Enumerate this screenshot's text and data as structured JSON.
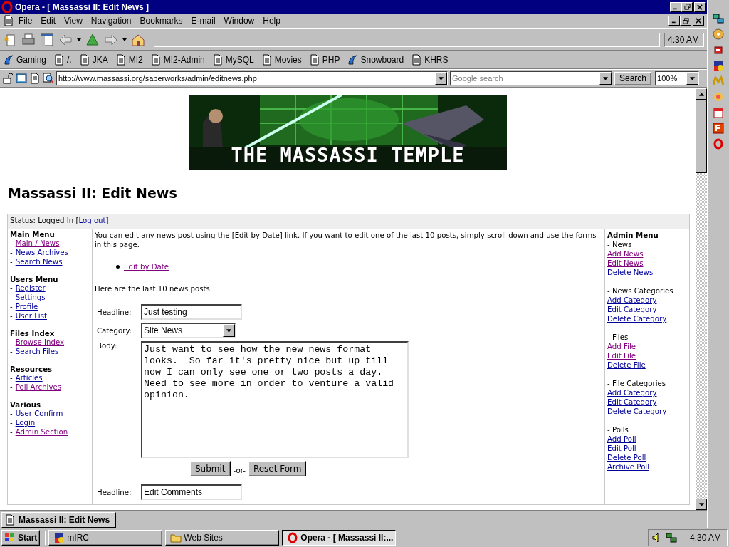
{
  "window": {
    "title": "Opera - [ Massassi II: Edit News ]"
  },
  "menu": [
    "File",
    "Edit",
    "View",
    "Navigation",
    "Bookmarks",
    "E-mail",
    "Window",
    "Help"
  ],
  "toolbar": {
    "clock": "4:30 AM"
  },
  "bookmarks": [
    {
      "label": "Gaming",
      "kind": "web"
    },
    {
      "label": "/.",
      "kind": "page"
    },
    {
      "label": "JKA",
      "kind": "page"
    },
    {
      "label": "MI2",
      "kind": "page"
    },
    {
      "label": "MI2-Admin",
      "kind": "page"
    },
    {
      "label": "MySQL",
      "kind": "page"
    },
    {
      "label": "Movies",
      "kind": "page"
    },
    {
      "label": "PHP",
      "kind": "page"
    },
    {
      "label": "Snowboard",
      "kind": "web"
    },
    {
      "label": "KHRS",
      "kind": "page"
    }
  ],
  "address": {
    "url": "http://www.massassi.org/saberworks/admin/editnews.php",
    "search_placeholder": "Google search",
    "search_button": "Search",
    "zoom": "100%"
  },
  "page": {
    "banner": {
      "title": "THE MASSASSI TEMPLE"
    },
    "heading": "Massassi II: Edit News",
    "status": {
      "text": "Status: Logged In [",
      "link": {
        "label": "Log out",
        "visited": false
      },
      "end": "]"
    },
    "left_menu": [
      {
        "title": "Main Menu",
        "links": [
          {
            "dash": "-",
            "label": "Main / News",
            "visited": true
          },
          {
            "dash": "-",
            "label": "News Archives",
            "visited": false
          },
          {
            "dash": "-",
            "label": "Search News",
            "visited": false
          }
        ]
      },
      {
        "title": "Users Menu",
        "links": [
          {
            "dash": "-",
            "label": "Register",
            "visited": false
          },
          {
            "dash": "-",
            "label": "Settings",
            "visited": false
          },
          {
            "dash": "-",
            "label": "Profile",
            "visited": false
          },
          {
            "dash": "-",
            "label": "User List",
            "visited": false
          }
        ]
      },
      {
        "title": "Files Index",
        "links": [
          {
            "dash": "-",
            "label": "Browse Index",
            "visited": true
          },
          {
            "dash": "-",
            "label": "Search Files",
            "visited": false
          }
        ]
      },
      {
        "title": "Resources",
        "links": [
          {
            "dash": "-",
            "label": "Articles",
            "visited": false
          },
          {
            "dash": "-",
            "label": "Poll Archives",
            "visited": true
          }
        ]
      },
      {
        "title": "Various",
        "links": [
          {
            "dash": "-",
            "label": "User Confirm",
            "visited": false
          },
          {
            "dash": "-",
            "label": "Login",
            "visited": false
          },
          {
            "dash": "-",
            "label": "Admin Section",
            "visited": true
          }
        ]
      }
    ],
    "intro": "You can edit any news post using the [Edit by Date] link. If you want to edit one of the last 10 posts, simply scroll down and use the forms in this page.",
    "bullet_links": [
      {
        "label": "Edit by Date",
        "visited": true
      }
    ],
    "lead": "Here are the last 10 news posts.",
    "form": {
      "headline_label": "Headline:",
      "headline": "Just testing",
      "category_label": "Category:",
      "category": "Site News",
      "body_label": "Body:",
      "body": "Just want to see how the new news format looks.  So far it's pretty nice but up till now I can only see one or two posts a day. Need to see more in order to venture a valid opinion.",
      "submit": "Submit",
      "or": "-or-",
      "reset": "Reset Form"
    },
    "next_form": {
      "headline_label": "Headline:",
      "headline": "Edit Comments"
    },
    "admin_menu": {
      "title": "Admin Menu",
      "groups": [
        {
          "heading": "- News",
          "links": [
            {
              "label": "Add News",
              "visited": true
            },
            {
              "label": "Edit News",
              "visited": true
            },
            {
              "label": "Delete News",
              "visited": false
            }
          ]
        },
        {
          "heading": "- News Categories",
          "links": [
            {
              "label": "Add Category",
              "visited": false
            },
            {
              "label": "Edit Category",
              "visited": false
            },
            {
              "label": "Delete Category",
              "visited": false
            }
          ]
        },
        {
          "heading": "- Files",
          "links": [
            {
              "label": "Add File",
              "visited": true
            },
            {
              "label": "Edit File",
              "visited": true
            },
            {
              "label": "Delete File",
              "visited": false
            }
          ]
        },
        {
          "heading": "- File Categories",
          "links": [
            {
              "label": "Add Category",
              "visited": false
            },
            {
              "label": "Edit Category",
              "visited": false
            },
            {
              "label": "Delete Category",
              "visited": false
            }
          ]
        },
        {
          "heading": "- Polls",
          "links": [
            {
              "label": "Add Poll",
              "visited": false
            },
            {
              "label": "Edit Poll",
              "visited": false
            },
            {
              "label": "Delete Poll",
              "visited": false
            },
            {
              "label": "Archive Poll",
              "visited": false
            }
          ]
        }
      ]
    }
  },
  "document_tabs": [
    {
      "label": "Massassi II: Edit News",
      "selected": true
    }
  ],
  "taskbar": {
    "start": "Start",
    "tasks": [
      {
        "label": "mIRC",
        "kind": "irc",
        "selected": false
      },
      {
        "label": "Web Sites",
        "kind": "folder",
        "selected": false
      },
      {
        "label": "Opera - [ Massassi II:...",
        "kind": "opera",
        "selected": true
      }
    ],
    "clock": "4:30 AM"
  }
}
